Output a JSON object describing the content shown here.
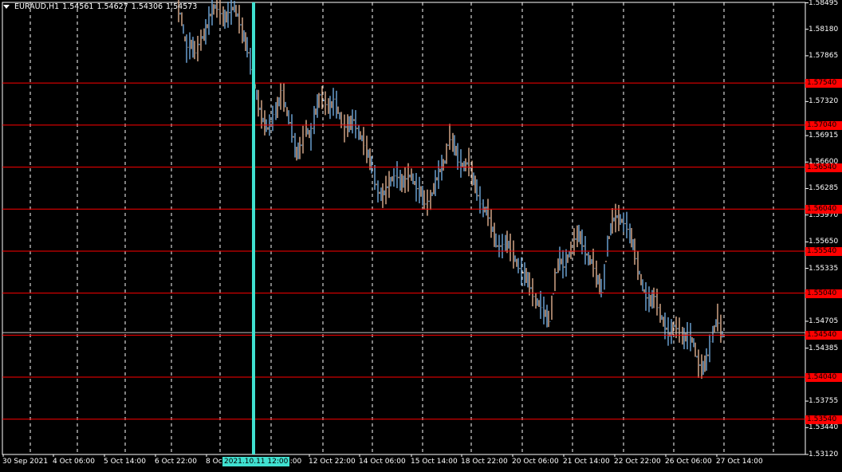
{
  "header": {
    "symbol": "EURAUD,H1",
    "open": "1.54561",
    "high": "1.54627",
    "low": "1.54306",
    "close": "1.54573"
  },
  "colors": {
    "background": "#000000",
    "grid": "#ffffff",
    "level_lines": "#ff0000",
    "bull_candle": "#6fa8dc",
    "bear_candle": "#e0b090",
    "vertical_marker": "#40e0d0",
    "current_price_line": "#c0c0c0"
  },
  "price_axis": {
    "labels": [
      "1.58495",
      "1.58180",
      "1.57865",
      "1.57320",
      "1.56915",
      "1.56600",
      "1.56285",
      "1.55970",
      "1.55650",
      "1.55335",
      "1.54705",
      "1.54385",
      "1.53755",
      "1.53440",
      "1.53120"
    ],
    "min": 1.5312,
    "max": 1.585
  },
  "level_lines": [
    "1.57540",
    "1.57040",
    "1.56540",
    "1.56040",
    "1.55540",
    "1.55040",
    "1.54540",
    "1.54040",
    "1.53540"
  ],
  "time_axis": {
    "labels": [
      "30 Sep 2021",
      "4 Oct 06:00",
      "5 Oct 14:00",
      "6 Oct 22:00",
      "8 Oc",
      "12 Oct 22:00",
      "14 Oct 06:00",
      "15 Oct 14:00",
      "18 Oct 22:00",
      "20 Oct 06:00",
      "21 Oct 14:00",
      "22 Oct 22:00",
      "26 Oct 06:00",
      "27 Oct 14:00"
    ],
    "label_after_marker": "4:00"
  },
  "vertical_marker": {
    "label": "2021.10.11 12:00"
  }
}
